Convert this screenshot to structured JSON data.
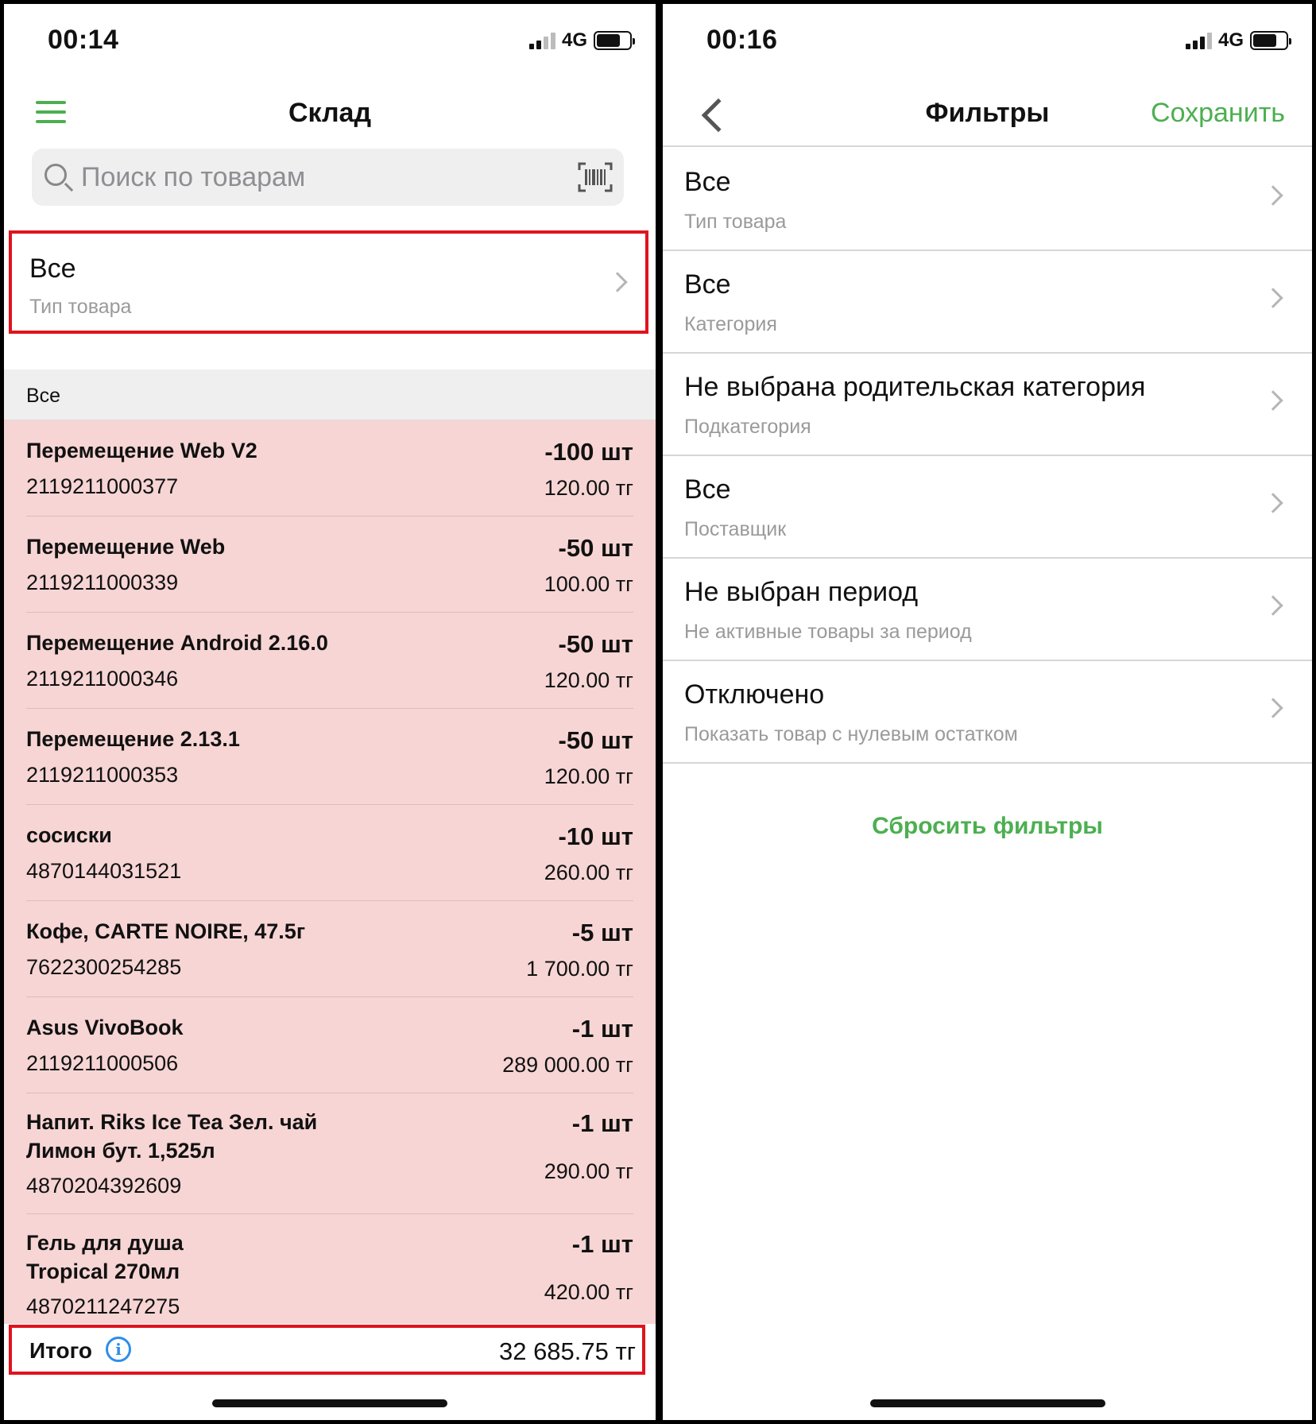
{
  "left": {
    "status": {
      "time": "00:14",
      "network": "4G"
    },
    "nav": {
      "title": "Склад"
    },
    "search": {
      "placeholder": "Поиск по товарам"
    },
    "filter": {
      "value": "Все",
      "label": "Тип товара"
    },
    "section": "Все",
    "items": [
      {
        "name": "Перемещение Web  V2",
        "code": "2119211000377",
        "qty": "-100 шт",
        "price": "120.00 тг"
      },
      {
        "name": "Перемещение Web",
        "code": "2119211000339",
        "qty": "-50 шт",
        "price": "100.00 тг"
      },
      {
        "name": "Перемещение Android 2.16.0",
        "code": "2119211000346",
        "qty": "-50 шт",
        "price": "120.00 тг"
      },
      {
        "name": "Перемещение 2.13.1",
        "code": "2119211000353",
        "qty": "-50 шт",
        "price": "120.00 тг"
      },
      {
        "name": "сосиски",
        "code": "4870144031521",
        "qty": "-10 шт",
        "price": "260.00 тг"
      },
      {
        "name": "Кофе, CARTE NOIRE, 47.5г",
        "code": "7622300254285",
        "qty": "-5 шт",
        "price": "1 700.00 тг"
      },
      {
        "name": "Asus VivoBook",
        "code": "2119211000506",
        "qty": "-1 шт",
        "price": "289 000.00 тг"
      },
      {
        "name_line1": "Напит. Riks Ice Tea Зел. чай",
        "name_line2": "Лимон бут. 1,525л",
        "code": "4870204392609",
        "qty": "-1 шт",
        "price": "290.00 тг"
      },
      {
        "name_line1": "Гель для душа",
        "name_line2": "Tropical 270мл",
        "code": "4870211247275",
        "qty": "-1 шт",
        "price": "420.00 тг"
      }
    ],
    "total": {
      "label": "Итого",
      "value": "32 685.75 тг"
    }
  },
  "right": {
    "status": {
      "time": "00:16",
      "network": "4G"
    },
    "nav": {
      "title": "Фильтры",
      "save": "Сохранить"
    },
    "filters": [
      {
        "value": "Все",
        "label": "Тип товара"
      },
      {
        "value": "Все",
        "label": "Категория"
      },
      {
        "value": "Не выбрана родительская категория",
        "label": "Подкатегория"
      },
      {
        "value": "Все",
        "label": "Поставщик"
      },
      {
        "value": "Не выбран период",
        "label": "Не активные товары за период"
      },
      {
        "value": "Отключено",
        "label": "Показать товар с нулевым остатком"
      }
    ],
    "reset": "Сбросить фильтры"
  },
  "colors": {
    "accent": "#4caf50",
    "highlight": "#e0131e",
    "negative_row": "#f6d5d4",
    "info": "#2d8ee8"
  }
}
